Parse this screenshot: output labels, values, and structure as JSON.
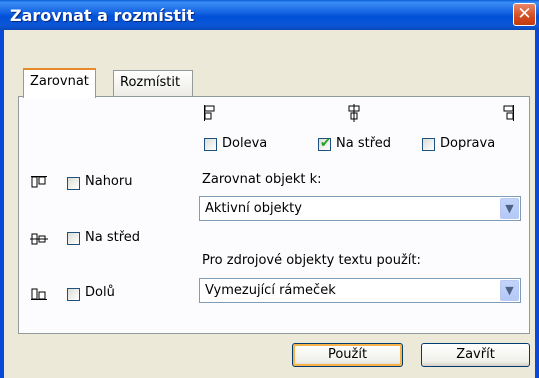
{
  "window": {
    "title": "Zarovnat a rozmístit",
    "close_glyph": "✕"
  },
  "tabs": [
    {
      "label": "Zarovnat",
      "active": true
    },
    {
      "label": "Rozmístit",
      "active": false
    }
  ],
  "horizontal": [
    {
      "label": "Doleva",
      "checked": false,
      "icon": "align-left-icon"
    },
    {
      "label": "Na střed",
      "checked": true,
      "icon": "align-center-horizontal-icon"
    },
    {
      "label": "Doprava",
      "checked": false,
      "icon": "align-right-icon"
    }
  ],
  "vertical": [
    {
      "label": "Nahoru",
      "checked": false,
      "icon": "align-top-icon"
    },
    {
      "label": "Na střed",
      "checked": false,
      "icon": "align-middle-vertical-icon"
    },
    {
      "label": "Dolů",
      "checked": false,
      "icon": "align-bottom-icon"
    }
  ],
  "align_to": {
    "label": "Zarovnat objekt k:",
    "value": "Aktivní objekty"
  },
  "text_source": {
    "label": "Pro zdrojové objekty textu použít:",
    "value": "Vymezující rámeček"
  },
  "buttons": {
    "apply": "Použít",
    "close": "Zavřít"
  }
}
